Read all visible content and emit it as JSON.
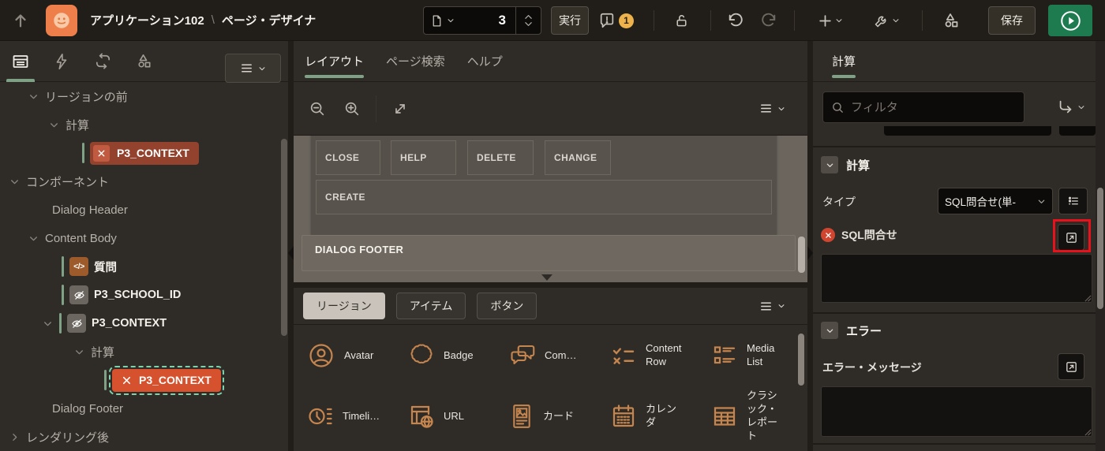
{
  "colors": {
    "accent-green": "#7fa287",
    "run-green": "#1e7b50",
    "logo-orange": "#ee7f4b",
    "warning-yellow": "#eeb24c",
    "node-red": "#93422e",
    "node-selected-orange": "#d6512d",
    "selection-teal": "#7fd0ab",
    "gallery-amber": "#c5854e",
    "annotation-red": "#e8111c"
  },
  "header": {
    "app_label": "アプリケーション102",
    "breadcrumb_separator": "\\",
    "page_label": "ページ・デザイナ",
    "page_number": "3",
    "run_label": "実行",
    "warning_count": "1",
    "save_label": "保存"
  },
  "tree": {
    "items": [
      {
        "label": "リージョンの前"
      },
      {
        "label": "計算"
      },
      {
        "label": "P3_CONTEXT"
      },
      {
        "label": "コンポーネント"
      },
      {
        "label": "Dialog Header"
      },
      {
        "label": "Content Body"
      },
      {
        "label": "質問"
      },
      {
        "label": "P3_SCHOOL_ID"
      },
      {
        "label": "P3_CONTEXT"
      },
      {
        "label": "計算"
      },
      {
        "label": "P3_CONTEXT"
      },
      {
        "label": "Dialog Footer"
      },
      {
        "label": "レンダリング後"
      }
    ]
  },
  "center": {
    "tabs": [
      {
        "label": "レイアウト"
      },
      {
        "label": "ページ検索"
      },
      {
        "label": "ヘルプ"
      }
    ],
    "canvas": {
      "buttons": [
        "CLOSE",
        "HELP",
        "DELETE",
        "CHANGE",
        "CREATE"
      ],
      "footer_label": "DIALOG FOOTER"
    },
    "gallery": {
      "tabs": [
        {
          "label": "リージョン"
        },
        {
          "label": "アイテム"
        },
        {
          "label": "ボタン"
        }
      ],
      "items": [
        {
          "label": "Avatar"
        },
        {
          "label": "Badge"
        },
        {
          "label": "Com…"
        },
        {
          "label": "Content Row"
        },
        {
          "label": "Media List"
        },
        {
          "label": "Timeli…"
        },
        {
          "label": "URL"
        },
        {
          "label": "カード"
        },
        {
          "label": "カレンダ"
        },
        {
          "label": "クラシック・レポート"
        }
      ]
    }
  },
  "right": {
    "tab_label": "計算",
    "filter_placeholder": "フィルタ",
    "computation": {
      "title": "計算",
      "type_label": "タイプ",
      "type_value": "SQL問合せ(単-",
      "sql_label": "SQL問合せ",
      "sql_value": ""
    },
    "error": {
      "title": "エラー",
      "message_label": "エラー・メッセージ",
      "message_value": ""
    }
  }
}
